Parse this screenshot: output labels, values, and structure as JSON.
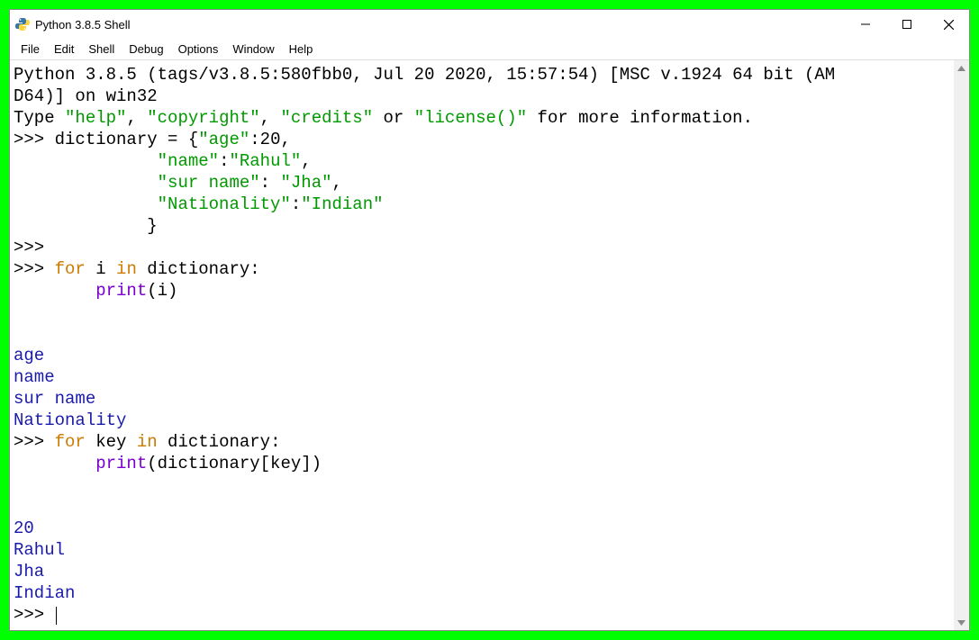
{
  "window": {
    "title": "Python 3.8.5 Shell"
  },
  "menu": {
    "items": [
      "File",
      "Edit",
      "Shell",
      "Debug",
      "Options",
      "Window",
      "Help"
    ]
  },
  "shell": {
    "banner1": "Python 3.8.5 (tags/v3.8.5:580fbb0, Jul 20 2020, 15:57:54) [MSC v.1924 64 bit (AM",
    "banner2": "D64)] on win32",
    "banner3a": "Type ",
    "banner3b": "\"help\"",
    "banner3c": ", ",
    "banner3d": "\"copyright\"",
    "banner3e": ", ",
    "banner3f": "\"credits\"",
    "banner3g": " or ",
    "banner3h": "\"license()\"",
    "banner3i": " for more information.",
    "prompt": ">>> ",
    "indent": "    ",
    "dict_line1a": "dictionary = {",
    "dict_key1": "\"age\"",
    "dict_sep": ":",
    "dict_val1": "20",
    "dict_comma": ",",
    "dict_pad": "              ",
    "dict_key2": "\"name\"",
    "dict_val2": "\"Rahul\"",
    "dict_key3": "\"sur name\"",
    "dict_val3_sep": ": ",
    "dict_val3": "\"Jha\"",
    "dict_key4": "\"Nationality\"",
    "dict_val4": "\"Indian\"",
    "dict_close_pad": "             ",
    "dict_close": "}",
    "for1a": "for",
    "for1b": " i ",
    "for1c": "in",
    "for1d": " dictionary:",
    "for1_body_a": "print",
    "for1_body_b": "(i)",
    "blank": "",
    "out1": "age",
    "out2": "name",
    "out3": "sur name",
    "out4": "Nationality",
    "for2a": "for",
    "for2b": " key ",
    "for2c": "in",
    "for2d": " dictionary:",
    "for2_body_a": "print",
    "for2_body_b": "(dictionary[key])",
    "out5": "20",
    "out6": "Rahul",
    "out7": "Jha",
    "out8": "Indian"
  }
}
